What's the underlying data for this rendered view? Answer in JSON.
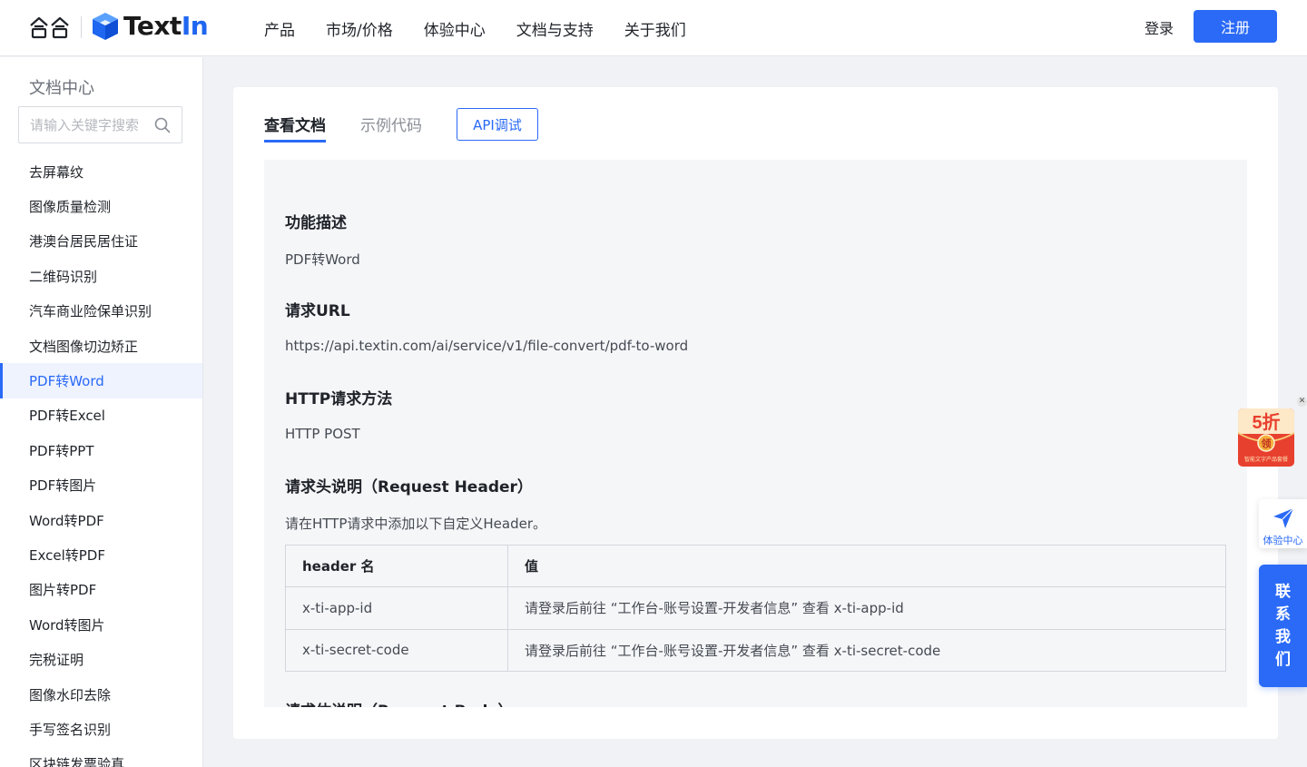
{
  "header": {
    "brand": {
      "text": "Text",
      "accent": "In"
    },
    "nav": [
      "产品",
      "市场/价格",
      "体验中心",
      "文档与支持",
      "关于我们"
    ],
    "login": "登录",
    "register": "注册"
  },
  "sidebar": {
    "title": "文档中心",
    "search_placeholder": "请输入关键字搜索",
    "items": [
      "去屏幕纹",
      "图像质量检测",
      "港澳台居民居住证",
      "二维码识别",
      "汽车商业险保单识别",
      "文档图像切边矫正",
      "PDF转Word",
      "PDF转Excel",
      "PDF转PPT",
      "PDF转图片",
      "Word转PDF",
      "Excel转PDF",
      "图片转PDF",
      "Word转图片",
      "完税证明",
      "图像水印去除",
      "手写签名识别",
      "区块链发票验真"
    ],
    "active_index": 6
  },
  "tabs": {
    "docs": "查看文档",
    "code": "示例代码",
    "api": "API调试"
  },
  "doc": {
    "func_title": "功能描述",
    "func_text": "PDF转Word",
    "url_title": "请求URL",
    "url_text": "https://api.textin.com/ai/service/v1/file-convert/pdf-to-word",
    "method_title": "HTTP请求方法",
    "method_text": "HTTP POST",
    "header_title": "请求头说明（Request Header）",
    "header_text": "请在HTTP请求中添加以下自定义Header。",
    "table": {
      "columns": [
        "header 名",
        "值"
      ],
      "rows": [
        [
          "x-ti-app-id",
          "请登录后前往 “工作台-账号设置-开发者信息” 查看 x-ti-app-id"
        ],
        [
          "x-ti-secret-code",
          "请登录后前往 “工作台-账号设置-开发者信息” 查看 x-ti-secret-code"
        ]
      ]
    },
    "body_title": "请求体说明（Request Body）"
  },
  "widgets": {
    "promo_discount": "5折",
    "promo_badge": "领",
    "promo_caption": "智能文字产品套餐",
    "experience": "体验中心",
    "contact": [
      "联",
      "系",
      "我",
      "们"
    ]
  },
  "colors": {
    "primary": "#2a6af6",
    "active_bg": "#eef3fe",
    "promo_red": "#e8402f",
    "promo_gold": "#f5b13c"
  }
}
